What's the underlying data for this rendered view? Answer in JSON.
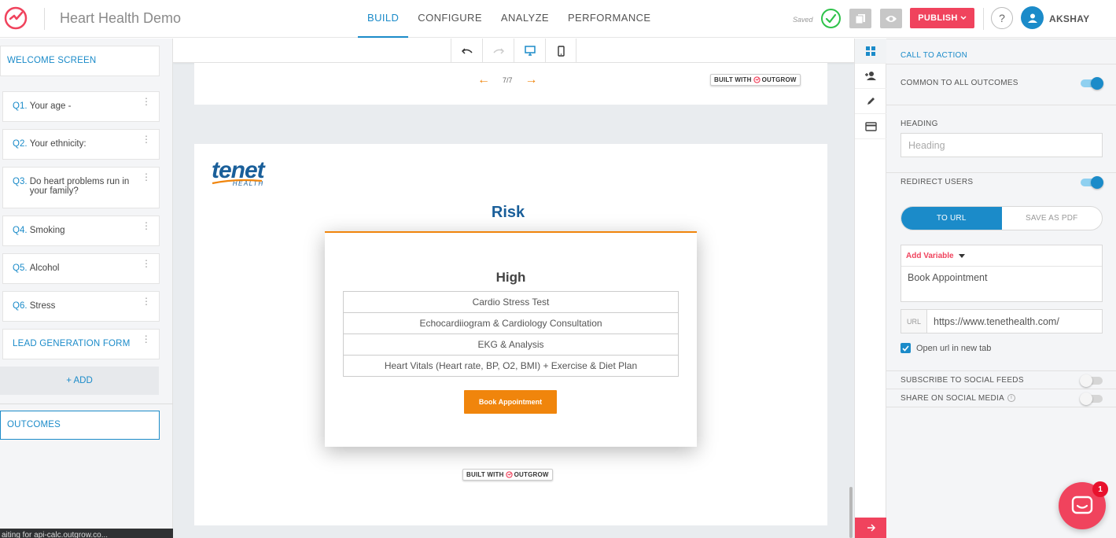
{
  "app": {
    "title": "Heart Health Demo"
  },
  "nav": {
    "tabs": [
      "BUILD",
      "CONFIGURE",
      "ANALYZE",
      "PERFORMANCE"
    ],
    "active": "BUILD"
  },
  "toolbar": {
    "saved_label": "Saved",
    "publish_label": "PUBLISH",
    "help_label": "?",
    "username": "AKSHAY"
  },
  "sidebar": {
    "welcome": "WELCOME SCREEN",
    "questions": [
      {
        "num": "Q1.",
        "text": "Your age -"
      },
      {
        "num": "Q2.",
        "text": "Your ethnicity:"
      },
      {
        "num": "Q3.",
        "text": "Do heart problems run in your family?"
      },
      {
        "num": "Q4.",
        "text": "Smoking"
      },
      {
        "num": "Q5.",
        "text": "Alcohol"
      },
      {
        "num": "Q6.",
        "text": "Stress"
      }
    ],
    "lead_form": "LEAD GENERATION FORM",
    "add_label": "+ ADD",
    "outcomes": "OUTCOMES",
    "status_toast": "aiting for api-calc.outgrow.co..."
  },
  "canvas": {
    "pager": {
      "text": "7/7"
    },
    "built_with": "BUILT WITH",
    "built_brand": "OUTGROW",
    "brand": {
      "word": "tenet",
      "sub": "HEALTH"
    },
    "outcome_heading": "Risk",
    "result": {
      "title": "High",
      "items": [
        "Cardio Stress Test",
        "Echocardiiogram & Cardiology Consultation",
        "EKG & Analysis",
        "Heart Vitals (Heart rate, BP, O2, BMI) + Exercise & Diet Plan"
      ],
      "cta": "Book Appointment"
    }
  },
  "panel": {
    "call_to_action": "CALL TO ACTION",
    "common_label": "COMMON TO ALL OUTCOMES",
    "common_on": true,
    "heading_label": "HEADING",
    "heading_placeholder": "Heading",
    "redirect_label": "REDIRECT USERS",
    "redirect_on": true,
    "redirect_modes": [
      "TO URL",
      "SAVE AS PDF"
    ],
    "active_mode": "TO URL",
    "add_variable": "Add Variable",
    "button_text": "Book Appointment",
    "url_prefix": "URL",
    "url_value": "https://www.tenethealth.com/",
    "open_new_tab": "Open url in new tab",
    "open_new_tab_checked": true,
    "subscribe_label": "SUBSCRIBE TO SOCIAL FEEDS",
    "subscribe_on": false,
    "share_label": "SHARE ON SOCIAL MEDIA",
    "share_on": false
  },
  "chat": {
    "badge": "1"
  },
  "colors": {
    "accent": "#1b8bc9",
    "brand_red": "#f0435d",
    "orange": "#f0850c",
    "tenet_blue": "#1a5f9a"
  }
}
